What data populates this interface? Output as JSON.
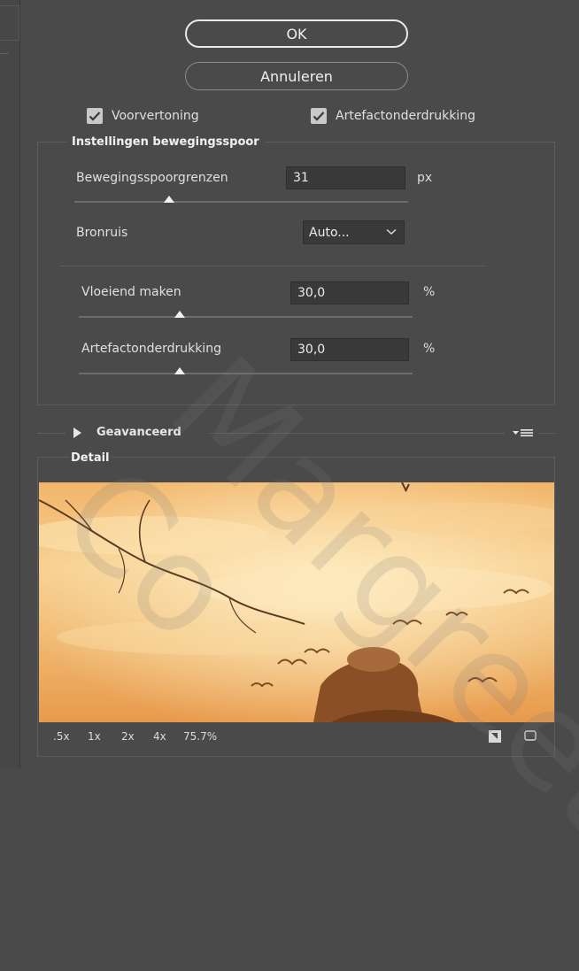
{
  "buttons": {
    "ok_label": "OK",
    "cancel_label": "Annuleren"
  },
  "options": {
    "preview_label": "Voorvertoning",
    "preview_checked": true,
    "artifact_label": "Artefactonderdrukking",
    "artifact_checked": true
  },
  "motion_settings": {
    "title": "Instellingen bewegingsspoor",
    "blur_trace_bounds": {
      "label": "Bewegingsspoorgrenzen",
      "value": "31",
      "unit": "px"
    },
    "source_noise": {
      "label": "Bronruis",
      "selected": "Auto..."
    },
    "smoothing": {
      "label": "Vloeiend maken",
      "value": "30,0",
      "unit": "%"
    },
    "artifact_suppression": {
      "label": "Artefactonderdrukking",
      "value": "30,0",
      "unit": "%"
    }
  },
  "advanced": {
    "label": "Geavanceerd"
  },
  "detail": {
    "title": "Detail",
    "zoom_options": [
      ".5x",
      "1x",
      "2x",
      "4x"
    ],
    "zoom_level": "75.7%"
  },
  "colors": {
    "panel_bg": "#4a4a4a",
    "field_bg": "#393939",
    "accent": "#e8e8e8"
  },
  "icons": [
    "checkmark-icon",
    "chevron-down-icon",
    "disclosure-triangle-icon",
    "panel-menu-icon",
    "detail-loupe-icon",
    "fit-view-icon"
  ],
  "watermark": "Margreet Co"
}
